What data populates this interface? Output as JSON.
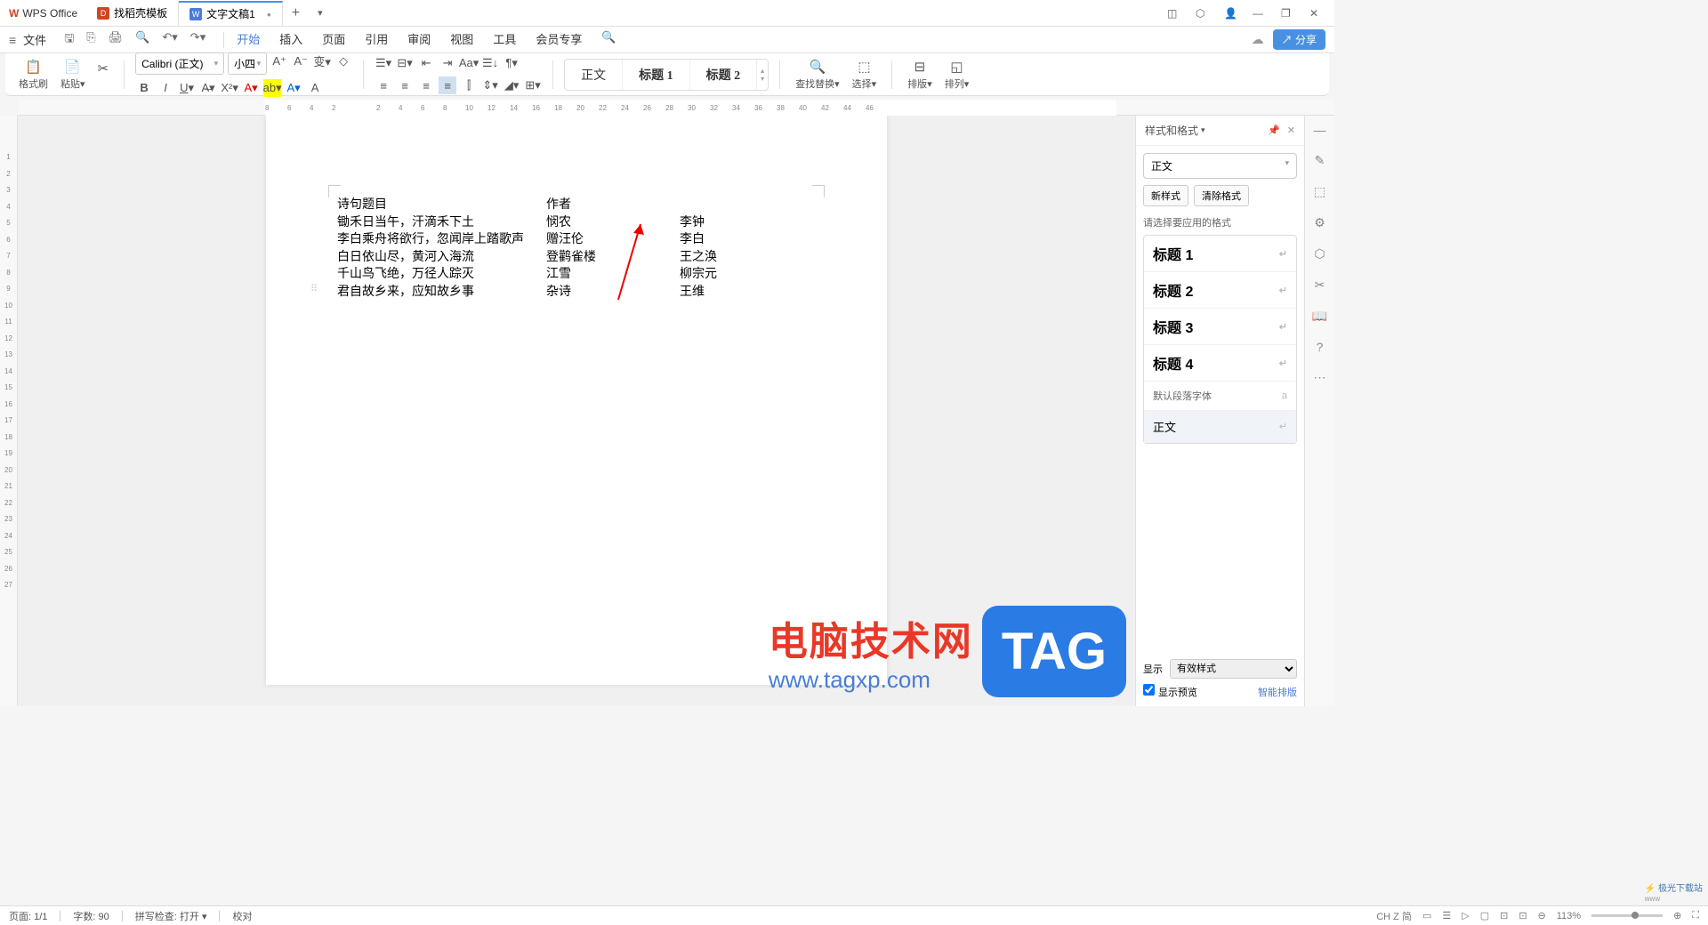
{
  "title_bar": {
    "app_name": "WPS Office",
    "tabs": [
      {
        "icon": "D",
        "label": "找稻壳模板"
      },
      {
        "icon": "W",
        "label": "文字文稿1",
        "dirty": "•"
      }
    ]
  },
  "menu_bar": {
    "file": "文件",
    "tabs": [
      "开始",
      "插入",
      "页面",
      "引用",
      "审阅",
      "视图",
      "工具",
      "会员专享"
    ],
    "share": "分享"
  },
  "toolbar": {
    "format_painter": "格式刷",
    "paste": "粘贴",
    "font": "Calibri (正文)",
    "size": "小四",
    "find_replace": "查找替换",
    "select": "选择",
    "layout": "排版",
    "arrange": "排列",
    "styles": {
      "normal": "正文",
      "h1": "标题 1",
      "h2": "标题 2"
    }
  },
  "ruler_h": [
    "8",
    "6",
    "4",
    "2",
    "",
    "2",
    "4",
    "6",
    "8",
    "10",
    "12",
    "14",
    "16",
    "18",
    "20",
    "22",
    "24",
    "26",
    "28",
    "30",
    "32",
    "34",
    "36",
    "38",
    "40",
    "42",
    "44",
    "46"
  ],
  "ruler_v": [
    "",
    "",
    "1",
    "2",
    "3",
    "4",
    "5",
    "6",
    "7",
    "8",
    "9",
    "10",
    "11",
    "12",
    "13",
    "14",
    "15",
    "16",
    "17",
    "18",
    "19",
    "20",
    "21",
    "22",
    "23",
    "24",
    "25",
    "26",
    "27"
  ],
  "document": {
    "rows": [
      {
        "c1": "诗句题目",
        "c2": "作者",
        "c3": ""
      },
      {
        "c1": "锄禾日当午，汗滴禾下土",
        "c2": "悯农",
        "c3": "李钟"
      },
      {
        "c1": "李白乘舟将欲行，忽闻岸上踏歌声",
        "c2": "赠汪伦",
        "c3": "李白"
      },
      {
        "c1": "白日依山尽，黄河入海流",
        "c2": "登鹳雀楼",
        "c3": "王之涣"
      },
      {
        "c1": "千山鸟飞绝，万径人踪灭",
        "c2": "江雪",
        "c3": "柳宗元"
      },
      {
        "c1": "君自故乡来，应知故乡事",
        "c2": "杂诗",
        "c3": "王维"
      }
    ]
  },
  "watermark": {
    "cn": "电脑技术网",
    "url": "www.tagxp.com",
    "tag": "TAG"
  },
  "styles_panel": {
    "title": "样式和格式",
    "current": "正文",
    "new_style": "新样式",
    "clear_format": "清除格式",
    "prompt": "请选择要应用的格式",
    "list": [
      {
        "label": "标题 1",
        "h": true
      },
      {
        "label": "标题 2",
        "h": true
      },
      {
        "label": "标题 3",
        "h": true
      },
      {
        "label": "标题 4",
        "h": true
      },
      {
        "label": "默认段落字体",
        "small": true
      },
      {
        "label": "正文",
        "selected": true
      }
    ],
    "show_label": "显示",
    "show_value": "有效样式",
    "preview_label": "显示预览",
    "smart_layout": "智能排版",
    "download_site": "极光下载站"
  },
  "status": {
    "page": "页面: 1/1",
    "words": "字数: 90",
    "spell": "拼写检查: 打开",
    "proof": "校对",
    "ime": "CH Z 简",
    "zoom": "113%"
  }
}
